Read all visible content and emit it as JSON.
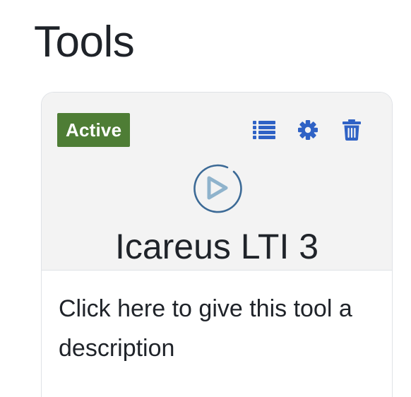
{
  "page": {
    "title": "Tools"
  },
  "tool_card": {
    "status": "Active",
    "name": "Icareus LTI 3",
    "description": "Click here to give this tool a description",
    "actions": [
      {
        "icon": "list-icon"
      },
      {
        "icon": "gear-icon"
      },
      {
        "icon": "trash-icon"
      }
    ]
  },
  "colors": {
    "status_badge_bg": "#4e7d35",
    "action_icon": "#2f62c5",
    "header_bg": "#f3f3f3",
    "logo_ring": "#3c6a96",
    "logo_play": "#8fb3cc"
  }
}
